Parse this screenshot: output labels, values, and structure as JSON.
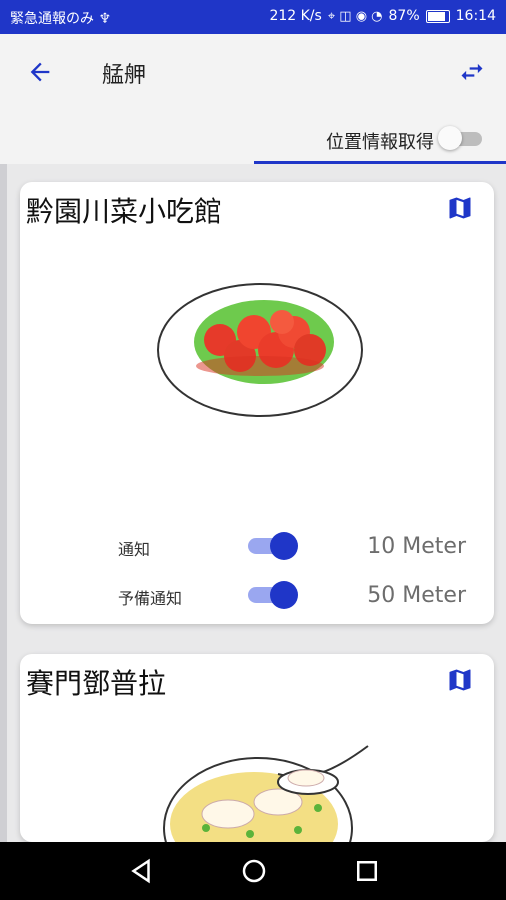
{
  "status_bar": {
    "left_text": "緊急通報のみ ♆",
    "network_speed": "212 K/s",
    "battery_percent": "87%",
    "time": "16:14"
  },
  "app_bar": {
    "title": "艋舺",
    "back_icon": "arrow-back-icon",
    "swap_icon": "swap-arrows-icon"
  },
  "location": {
    "label": "位置情報取得",
    "enabled": false
  },
  "colors": {
    "accent": "#1f36c8",
    "statusbar": "#1f36c8"
  },
  "cards": [
    {
      "name": "黔園川菜小吃館",
      "map_icon": "map-icon",
      "image": "shrimp-dish-illustration",
      "rows": [
        {
          "label": "通知",
          "enabled": true,
          "value": "10 Meter"
        },
        {
          "label": "予備通知",
          "enabled": true,
          "value": "50 Meter"
        }
      ]
    },
    {
      "name": "賽門鄧普拉",
      "map_icon": "map-icon",
      "image": "dumpling-soup-illustration"
    }
  ],
  "nav": {
    "back": "nav-back-icon",
    "home": "nav-home-icon",
    "recents": "nav-recents-icon"
  }
}
